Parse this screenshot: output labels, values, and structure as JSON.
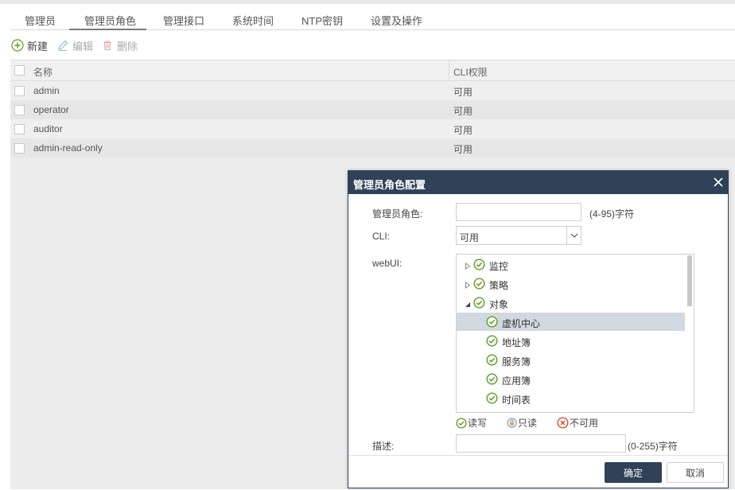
{
  "tabs": [
    {
      "label": "管理员"
    },
    {
      "label": "管理员角色"
    },
    {
      "label": "管理接口"
    },
    {
      "label": "系统时间"
    },
    {
      "label": "NTP密钥"
    },
    {
      "label": "设置及操作"
    }
  ],
  "toolbar": {
    "new_label": "新建",
    "edit_label": "编辑",
    "delete_label": "删除"
  },
  "grid": {
    "columns": [
      "名称",
      "CLI权限"
    ],
    "rows": [
      {
        "name": "admin",
        "cli": "可用"
      },
      {
        "name": "operator",
        "cli": "可用"
      },
      {
        "name": "auditor",
        "cli": "可用"
      },
      {
        "name": "admin-read-only",
        "cli": "可用"
      }
    ]
  },
  "dialog": {
    "title": "管理员角色配置",
    "role_label": "管理员角色:",
    "role_value": "",
    "role_hint": "(4-95)字符",
    "cli_label": "CLI:",
    "cli_value": "可用",
    "webui_label": "webUI:",
    "tree": [
      {
        "label": "监控",
        "level": 0,
        "expanded": false,
        "selected": false
      },
      {
        "label": "策略",
        "level": 0,
        "expanded": false,
        "selected": false
      },
      {
        "label": "对象",
        "level": 0,
        "expanded": true,
        "selected": false
      },
      {
        "label": "虚机中心",
        "level": 1,
        "selected": true
      },
      {
        "label": "地址簿",
        "level": 1,
        "selected": false
      },
      {
        "label": "服务簿",
        "level": 1,
        "selected": false
      },
      {
        "label": "应用簿",
        "level": 1,
        "selected": false
      },
      {
        "label": "时间表",
        "level": 1,
        "selected": false
      }
    ],
    "legend": {
      "read_write": "读写",
      "read_only": "只读",
      "unavailable": "不可用"
    },
    "desc_label": "描述:",
    "desc_value": "",
    "desc_hint": "(0-255)字符",
    "ok_label": "确定",
    "cancel_label": "取消"
  },
  "colors": {
    "dialog_header": "#2f4257",
    "check_green": "#5a9e1f",
    "deny_red": "#d9532c",
    "selected_row": "#d2d8e0"
  }
}
